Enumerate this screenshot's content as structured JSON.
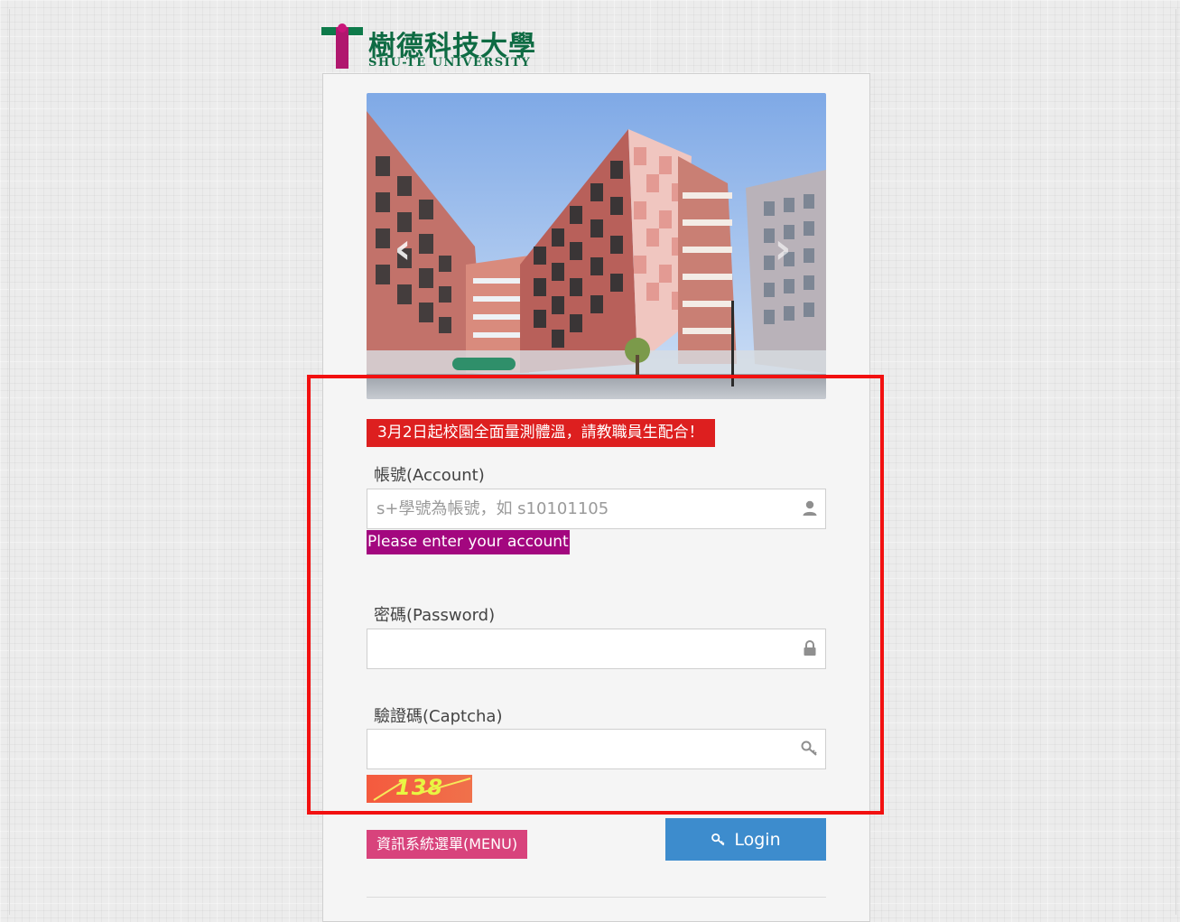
{
  "logo": {
    "name_cn": "樹德科技大學",
    "name_en": "SHU-TE UNIVERSITY",
    "colors": {
      "green": "#0e7a4a",
      "magenta": "#b0176e"
    }
  },
  "carousel": {
    "image_icon": "campus-building-photo",
    "prev_icon": "chevron-left-icon",
    "next_icon": "chevron-right-icon"
  },
  "announcement": {
    "text": "3月2日起校園全面量測體溫，請教職員生配合！",
    "color": "#dd1f1f"
  },
  "account": {
    "label": "帳號(Account)",
    "placeholder": "s+學號為帳號，如 s10101105",
    "value": "",
    "icon": "user-icon",
    "error": "Please enter your account",
    "error_color": "#a3077f"
  },
  "password": {
    "label": "密碼(Password)",
    "value": "",
    "icon": "lock-icon"
  },
  "captcha": {
    "label": "驗證碼(Captcha)",
    "value": "",
    "icon": "key-icon",
    "image_text": "138"
  },
  "buttons": {
    "menu_label": "資訊系統選單(MENU)",
    "menu_color": "#d8437c",
    "login_label": "Login",
    "login_icon": "key-icon",
    "login_color": "#3d8ccd"
  },
  "highlight_color": "#f21010"
}
